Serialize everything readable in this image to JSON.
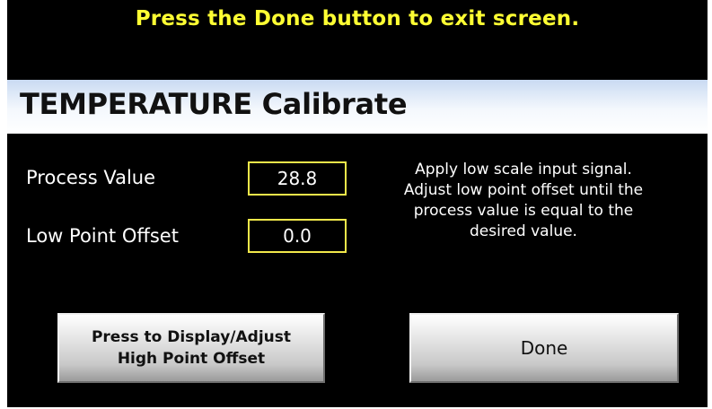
{
  "banner": {
    "text": "Press the Done button to exit screen.",
    "color": "#ffff33"
  },
  "header": {
    "title": "TEMPERATURE Calibrate"
  },
  "fields": {
    "process_value": {
      "label": "Process Value",
      "value": "28.8"
    },
    "low_point_offset": {
      "label": "Low Point Offset",
      "value": "0.0"
    }
  },
  "instructions": {
    "text": "Apply low scale input signal.\nAdjust low point offset until the\nprocess value is equal to the\ndesired value."
  },
  "buttons": {
    "high_point": {
      "label": "Press to Display/Adjust\nHigh Point Offset"
    },
    "done": {
      "label": "Done"
    }
  },
  "colors": {
    "background": "#000000",
    "field_border": "#f2e84a",
    "text": "#ffffff"
  }
}
